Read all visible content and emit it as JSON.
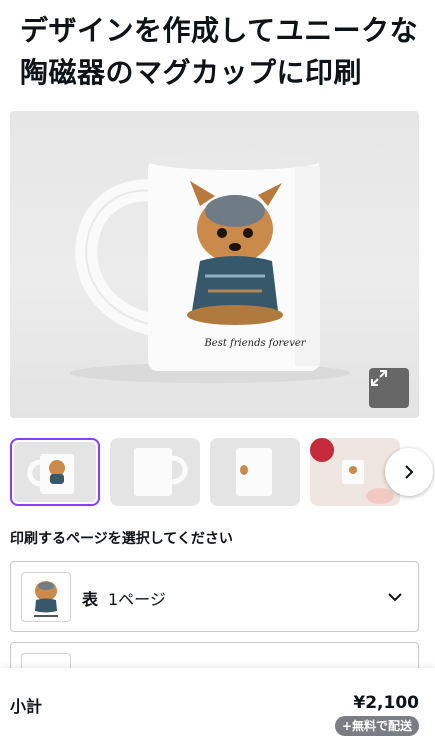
{
  "product": {
    "title": "デザインを作成してユニークな陶磁器のマグカップに印刷",
    "mug_print_text": "Best friends forever",
    "accent_color": "#8b3dff"
  },
  "gallery": {
    "expand_icon": "expand-icon",
    "next_icon": "chevron-right-icon",
    "thumbnails": [
      {
        "label": "mug-front-with-dog-print",
        "selected": true
      },
      {
        "label": "plain-mug-handle-right",
        "selected": false
      },
      {
        "label": "mug-side-view",
        "selected": false
      },
      {
        "label": "mug-lifestyle-scene",
        "selected": false
      }
    ]
  },
  "page_selector": {
    "label": "印刷するページを選択してください",
    "side": "表",
    "page_count": "1ページ",
    "chevron_icon": "chevron-down-icon"
  },
  "footer": {
    "subtotal_label": "小計",
    "subtotal_price": "¥2,100",
    "shipping_badge": "+無料で配送"
  }
}
